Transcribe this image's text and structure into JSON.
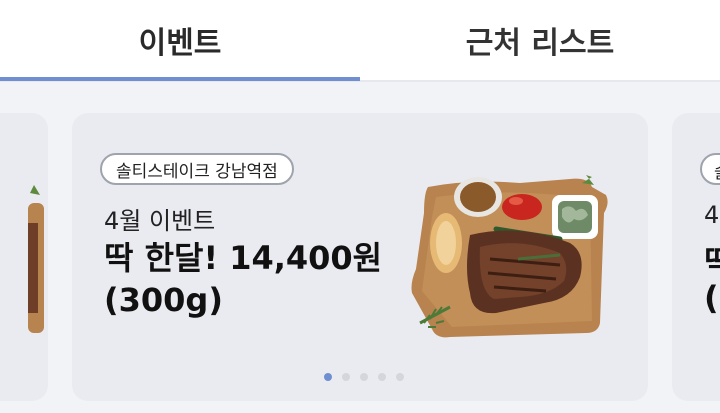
{
  "tabs": [
    {
      "label": "이벤트",
      "active": true
    },
    {
      "label": "근처 리스트",
      "active": false
    }
  ],
  "event": {
    "store": "솔티스테이크 강남역점",
    "month": "4월 이벤트",
    "headline_line1": "딱 한달! 14,400원",
    "headline_line2": "(300g)"
  },
  "next_card": {
    "badge_char": "솔",
    "month_char": "4",
    "headline_char": "딱",
    "line2_char": "("
  },
  "pagination": {
    "total": 5,
    "active_index": 0
  },
  "colors": {
    "accent": "#6f8fd1",
    "card_bg": "#eaebf1",
    "page_bg": "#f2f3f6"
  }
}
